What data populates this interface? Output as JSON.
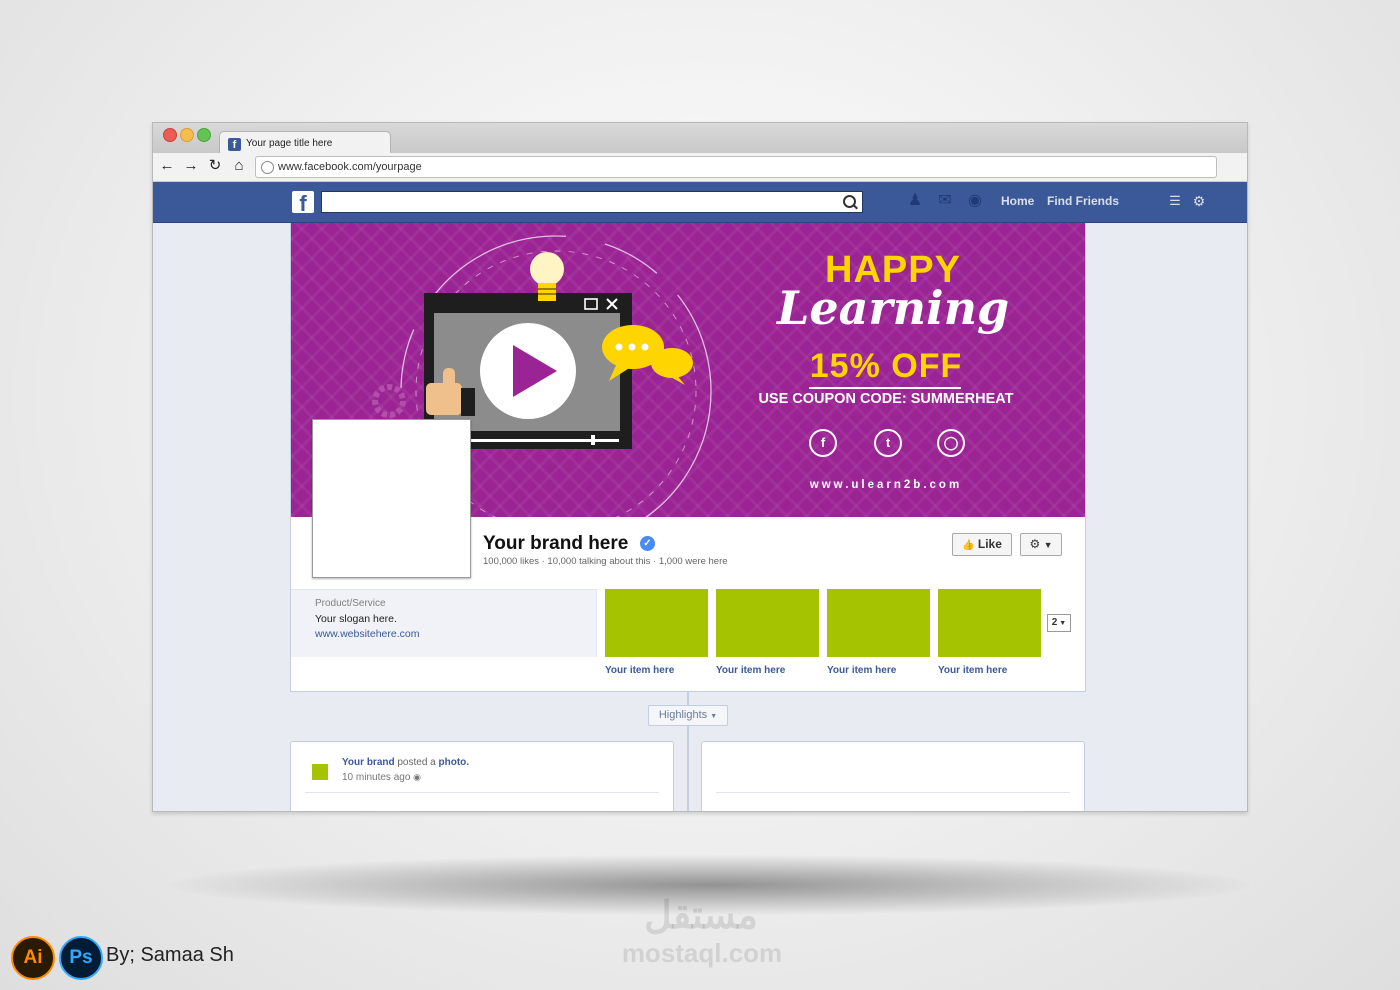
{
  "browser": {
    "tab_title": "Your page title here",
    "favicon": "facebook-icon",
    "url": "www.facebook.com/yourpage"
  },
  "fb_nav": {
    "home": "Home",
    "find_friends": "Find Friends"
  },
  "cover": {
    "headline": "HAPPY",
    "script": "Learning",
    "discount": "15%  OFF",
    "coupon": "USE COUPON CODE: SUMMERHEAT",
    "website": "www.ulearn2b.com",
    "social_icons": [
      "facebook-icon",
      "twitter-icon",
      "instagram-icon"
    ],
    "accent_color": "#ffd500",
    "background_color": "#9b2494"
  },
  "page": {
    "brand_name": "Your brand here",
    "stats": "100,000 likes · 10,000 talking about this · 1,000 were here",
    "like_button": "Like",
    "category": "Product/Service",
    "slogan": "Your slogan here.",
    "website": "www.websitehere.com",
    "apps": [
      "Your item here",
      "Your item here",
      "Your item here",
      "Your item here"
    ],
    "apps_more": "2",
    "app_color": "#a5c300"
  },
  "timeline": {
    "highlights": "Highlights",
    "post": {
      "author": "Your brand",
      "action": "posted a",
      "object": "photo.",
      "time": "10 minutes ago"
    }
  },
  "footer": {
    "ai_badge": "Ai",
    "ps_badge": "Ps",
    "credit": "By; Samaa Sh",
    "watermark_ar": "مستقل",
    "watermark_en": "mostaql.com"
  }
}
